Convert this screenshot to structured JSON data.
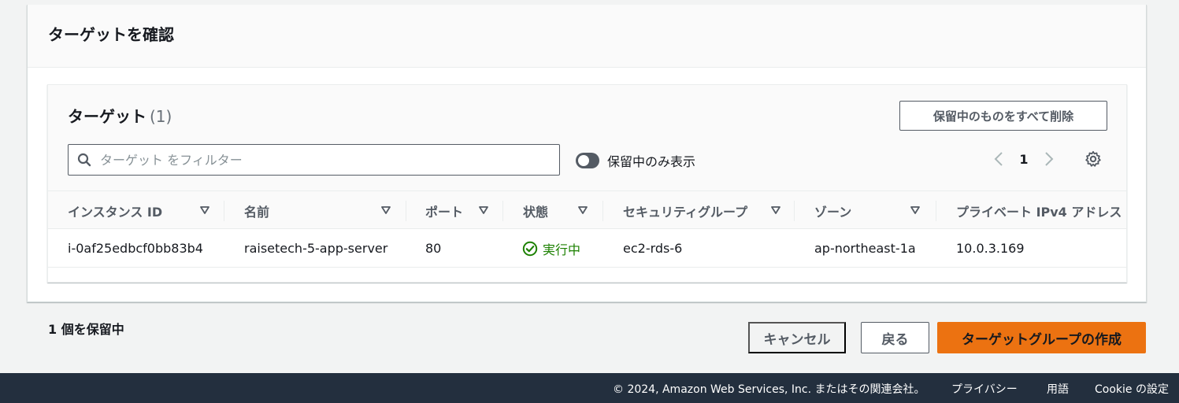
{
  "review": {
    "title": "ターゲットを確認"
  },
  "targets": {
    "title": "ターゲット",
    "count": "(1)",
    "remove_pending_label": "保留中のものをすべて削除",
    "search_placeholder": "ターゲット をフィルター",
    "search_value": "",
    "toggle_label": "保留中のみ表示",
    "toggle_on": false,
    "page": "1",
    "columns": [
      "インスタンス ID",
      "名前",
      "ポート",
      "状態",
      "セキュリティグループ",
      "ゾーン",
      "プライベート IPv4 アドレス"
    ],
    "rows": [
      {
        "instance_id": "i-0af25edbcf0bb83b4",
        "name": "raisetech-5-app-server",
        "port": "80",
        "state": "実行中",
        "security_group": "ec2-rds-6",
        "zone": "ap-northeast-1a",
        "private_ip": "10.0.3.169"
      }
    ]
  },
  "actions": {
    "pending_text": "1 個を保留中",
    "cancel_label": "キャンセル",
    "back_label": "戻る",
    "create_label": "ターゲットグループの作成"
  },
  "footer": {
    "copyright": "© 2024, Amazon Web Services, Inc. またはその関連会社。",
    "privacy": "プライバシー",
    "terms": "用語",
    "cookie": "Cookie の設定"
  },
  "colors": {
    "primary": "#ec7211",
    "success": "#1d8102",
    "footer_bg": "#232f3e"
  }
}
